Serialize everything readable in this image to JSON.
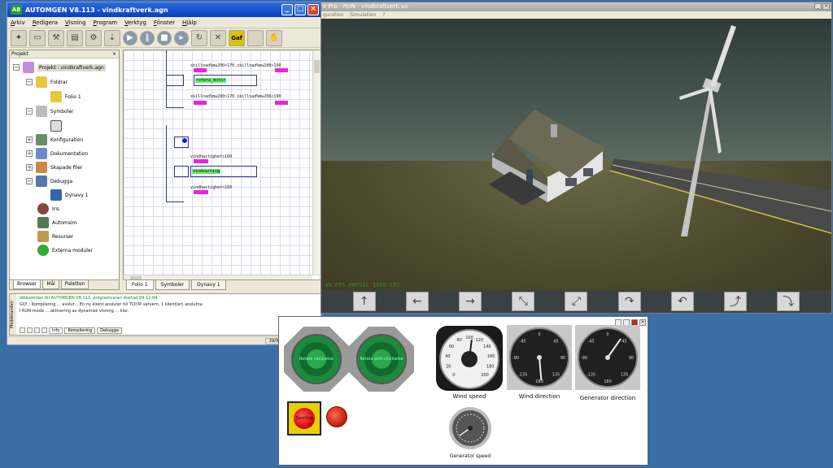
{
  "main_window": {
    "title": "AUTOMGEN V8.113 - vindkraftverk.agn",
    "app_icon": "A8",
    "menu": [
      "Arkiv",
      "Redigera",
      "Visning",
      "Program",
      "Verktyg",
      "Fönster",
      "Hjälp"
    ],
    "toolbar_icons": [
      "wand-icon",
      "folder-open-icon",
      "build-icon",
      "print-icon",
      "compile-icon",
      "download-icon",
      "play-icon",
      "pause-icon",
      "stop-icon",
      "step-icon",
      "connect-icon",
      "disconnect-icon",
      "gaf-icon",
      "blank-icon",
      "hand-icon"
    ],
    "gaf_label": "Gaf",
    "project_panel": {
      "header": "Projekt",
      "root": "Projekt : vindkraftverk.agn",
      "items": [
        {
          "label": "Foldrar",
          "color": "#e8c640"
        },
        {
          "label": "Folio 1",
          "color": "#e8c640"
        },
        {
          "label": "Symboler",
          "color": "#888888"
        },
        {
          "label": "Konfiguration",
          "color": "#6a8a6a"
        },
        {
          "label": "Dokumentation",
          "color": "#6a8acc"
        },
        {
          "label": "Skapade filer",
          "color": "#cc8844"
        },
        {
          "label": "Debugga",
          "color": "#5577aa"
        },
        {
          "label": "Dynavy 1",
          "color": "#3366aa"
        },
        {
          "label": "Iris",
          "color": "#884444"
        },
        {
          "label": "Automsim",
          "color": "#557755"
        },
        {
          "label": "Resurser",
          "color": "#bb9955"
        },
        {
          "label": "Externa moduler",
          "color": "#33aa33"
        }
      ],
      "tabs": [
        "Browser",
        "Mål",
        "Paletten"
      ]
    },
    "editor": {
      "conditions": [
        "skillnad%mw200<170.skillnad%mw200>190",
        "skillnad%mw200>170.skillnad%mw200<190",
        "vindhastighet>160",
        "vindhastighet<160"
      ],
      "actions": [
        "rotera_motor",
        "vindvarning"
      ]
    },
    "folio_tabs": [
      "Folio 1",
      "Symboler",
      "Dynavy 1"
    ],
    "messages": {
      "side_label": "Meddelanden",
      "lines": [
        "Välkommen till AUTOMGEN V8.113, programvaran startad 09:12:04",
        "GO! : Kompilering ... avslut... En ny klient ansluter till TCP/IP servern, 1 klient(er) anslutna",
        "I RUN-mode ... aktivering av dynamisk visning ... klar."
      ],
      "tabs": [
        "Info",
        "Kompilering",
        "Debugga"
      ]
    },
    "status": "29/9"
  },
  "sim_window": {
    "title": "e Pro - RUN - vindkraftverk.vo",
    "menu": [
      "guration",
      "Simulation",
      "?"
    ],
    "fps_text": "45 FPS   PHYSIC 1000 CPS",
    "controls": [
      "arrow-up-icon",
      "arrow-left-icon",
      "arrow-right-icon",
      "zoom-in-icon",
      "zoom-out-icon",
      "rotate-right-icon",
      "rotate-left-icon",
      "tilt-up-icon",
      "tilt-down-icon"
    ]
  },
  "dynavy": {
    "buttons": [
      "Rotate clockwise",
      "Rotate anti-clockwise"
    ],
    "estop_label": "Seniting",
    "gauges": [
      {
        "label": "Wind speed",
        "value": 105
      },
      {
        "label": "Wind direction",
        "value": 175
      },
      {
        "label": "Generator direction",
        "value": 35
      },
      {
        "label": "Generator speed",
        "value": 0
      }
    ],
    "wind_speed_ticks": [
      "0",
      "20",
      "40",
      "60",
      "80",
      "100",
      "120",
      "140",
      "160",
      "180",
      "200"
    ],
    "dir_ticks": [
      "0",
      "45",
      "90",
      "135",
      "180",
      "-135",
      "-90",
      "-45"
    ]
  }
}
